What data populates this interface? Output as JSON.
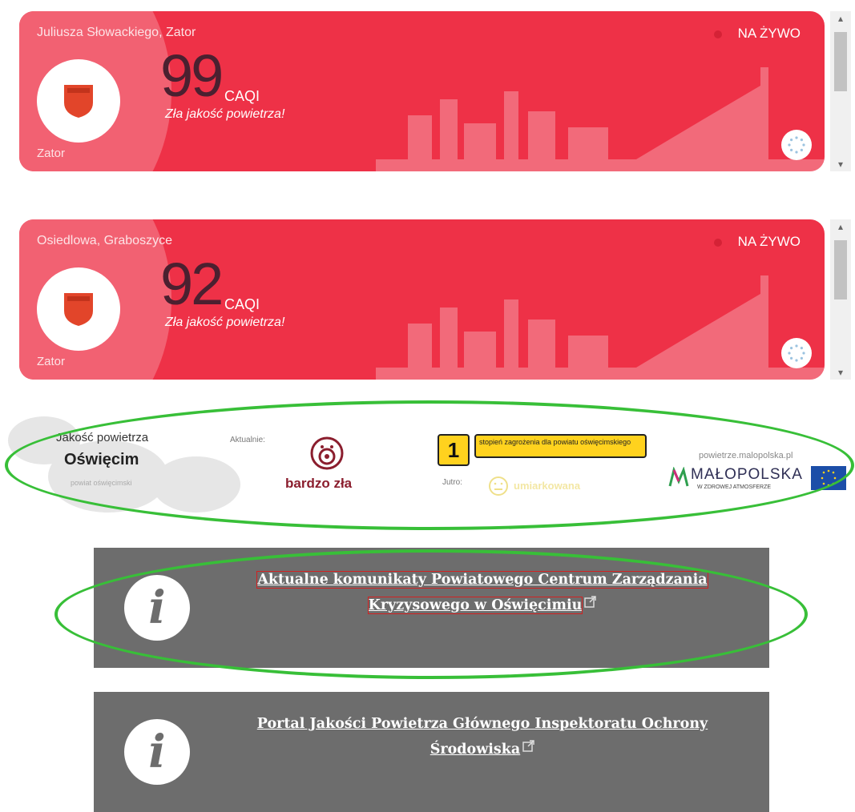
{
  "cards": [
    {
      "station": "Juliusza Słowackiego, Zator",
      "city": "Zator",
      "value": "99",
      "unit": "CAQI",
      "description": "Zła jakość powietrza!",
      "live": "NA ŻYWO"
    },
    {
      "station": "Osiedlowa, Graboszyce",
      "city": "Zator",
      "value": "92",
      "unit": "CAQI",
      "description": "Zła jakość powietrza!",
      "live": "NA ŻYWO"
    }
  ],
  "scrollbar": {
    "up": "▴",
    "down": "▾"
  },
  "banner": {
    "title": "Jakość powietrza",
    "city": "Oświęcim",
    "county": "powiat oświęcimski",
    "now_label": "Aktualnie:",
    "now_value": "bardzo zła",
    "level": "1",
    "level_text": "stopień zagrożenia dla powiatu oświęcimskiego",
    "tomorrow_label": "Jutro:",
    "tomorrow_value": "umiarkowana",
    "url": "powietrze.malopolska.pl",
    "logo_name": "MAŁOPOLSKA",
    "logo_sub": "W ZDROWEJ ATMOSFERZE"
  },
  "info_boxes": [
    {
      "line1": "Aktualne komunikaty Powiatowego Centrum Zarządzania",
      "line2": "Kryzysowego w Oświęcimiu"
    },
    {
      "line1": "Portal Jakości Powietrza Głównego Inspektoratu Ochrony",
      "line2": "Środowiska"
    }
  ],
  "info_icon_glyph": "i",
  "colors": {
    "card_red": "#ee3147",
    "card_panel": "#f26172",
    "info_gray": "#6d6d6d",
    "annotation_green": "#38bf38",
    "level_yellow": "#ffd21e",
    "bad_quality": "#8b1e2e"
  },
  "icons": [
    "coat-of-arms-icon",
    "refresh-spinner-icon",
    "info-icon",
    "external-link-icon",
    "face-icon",
    "eu-flag-icon"
  ]
}
